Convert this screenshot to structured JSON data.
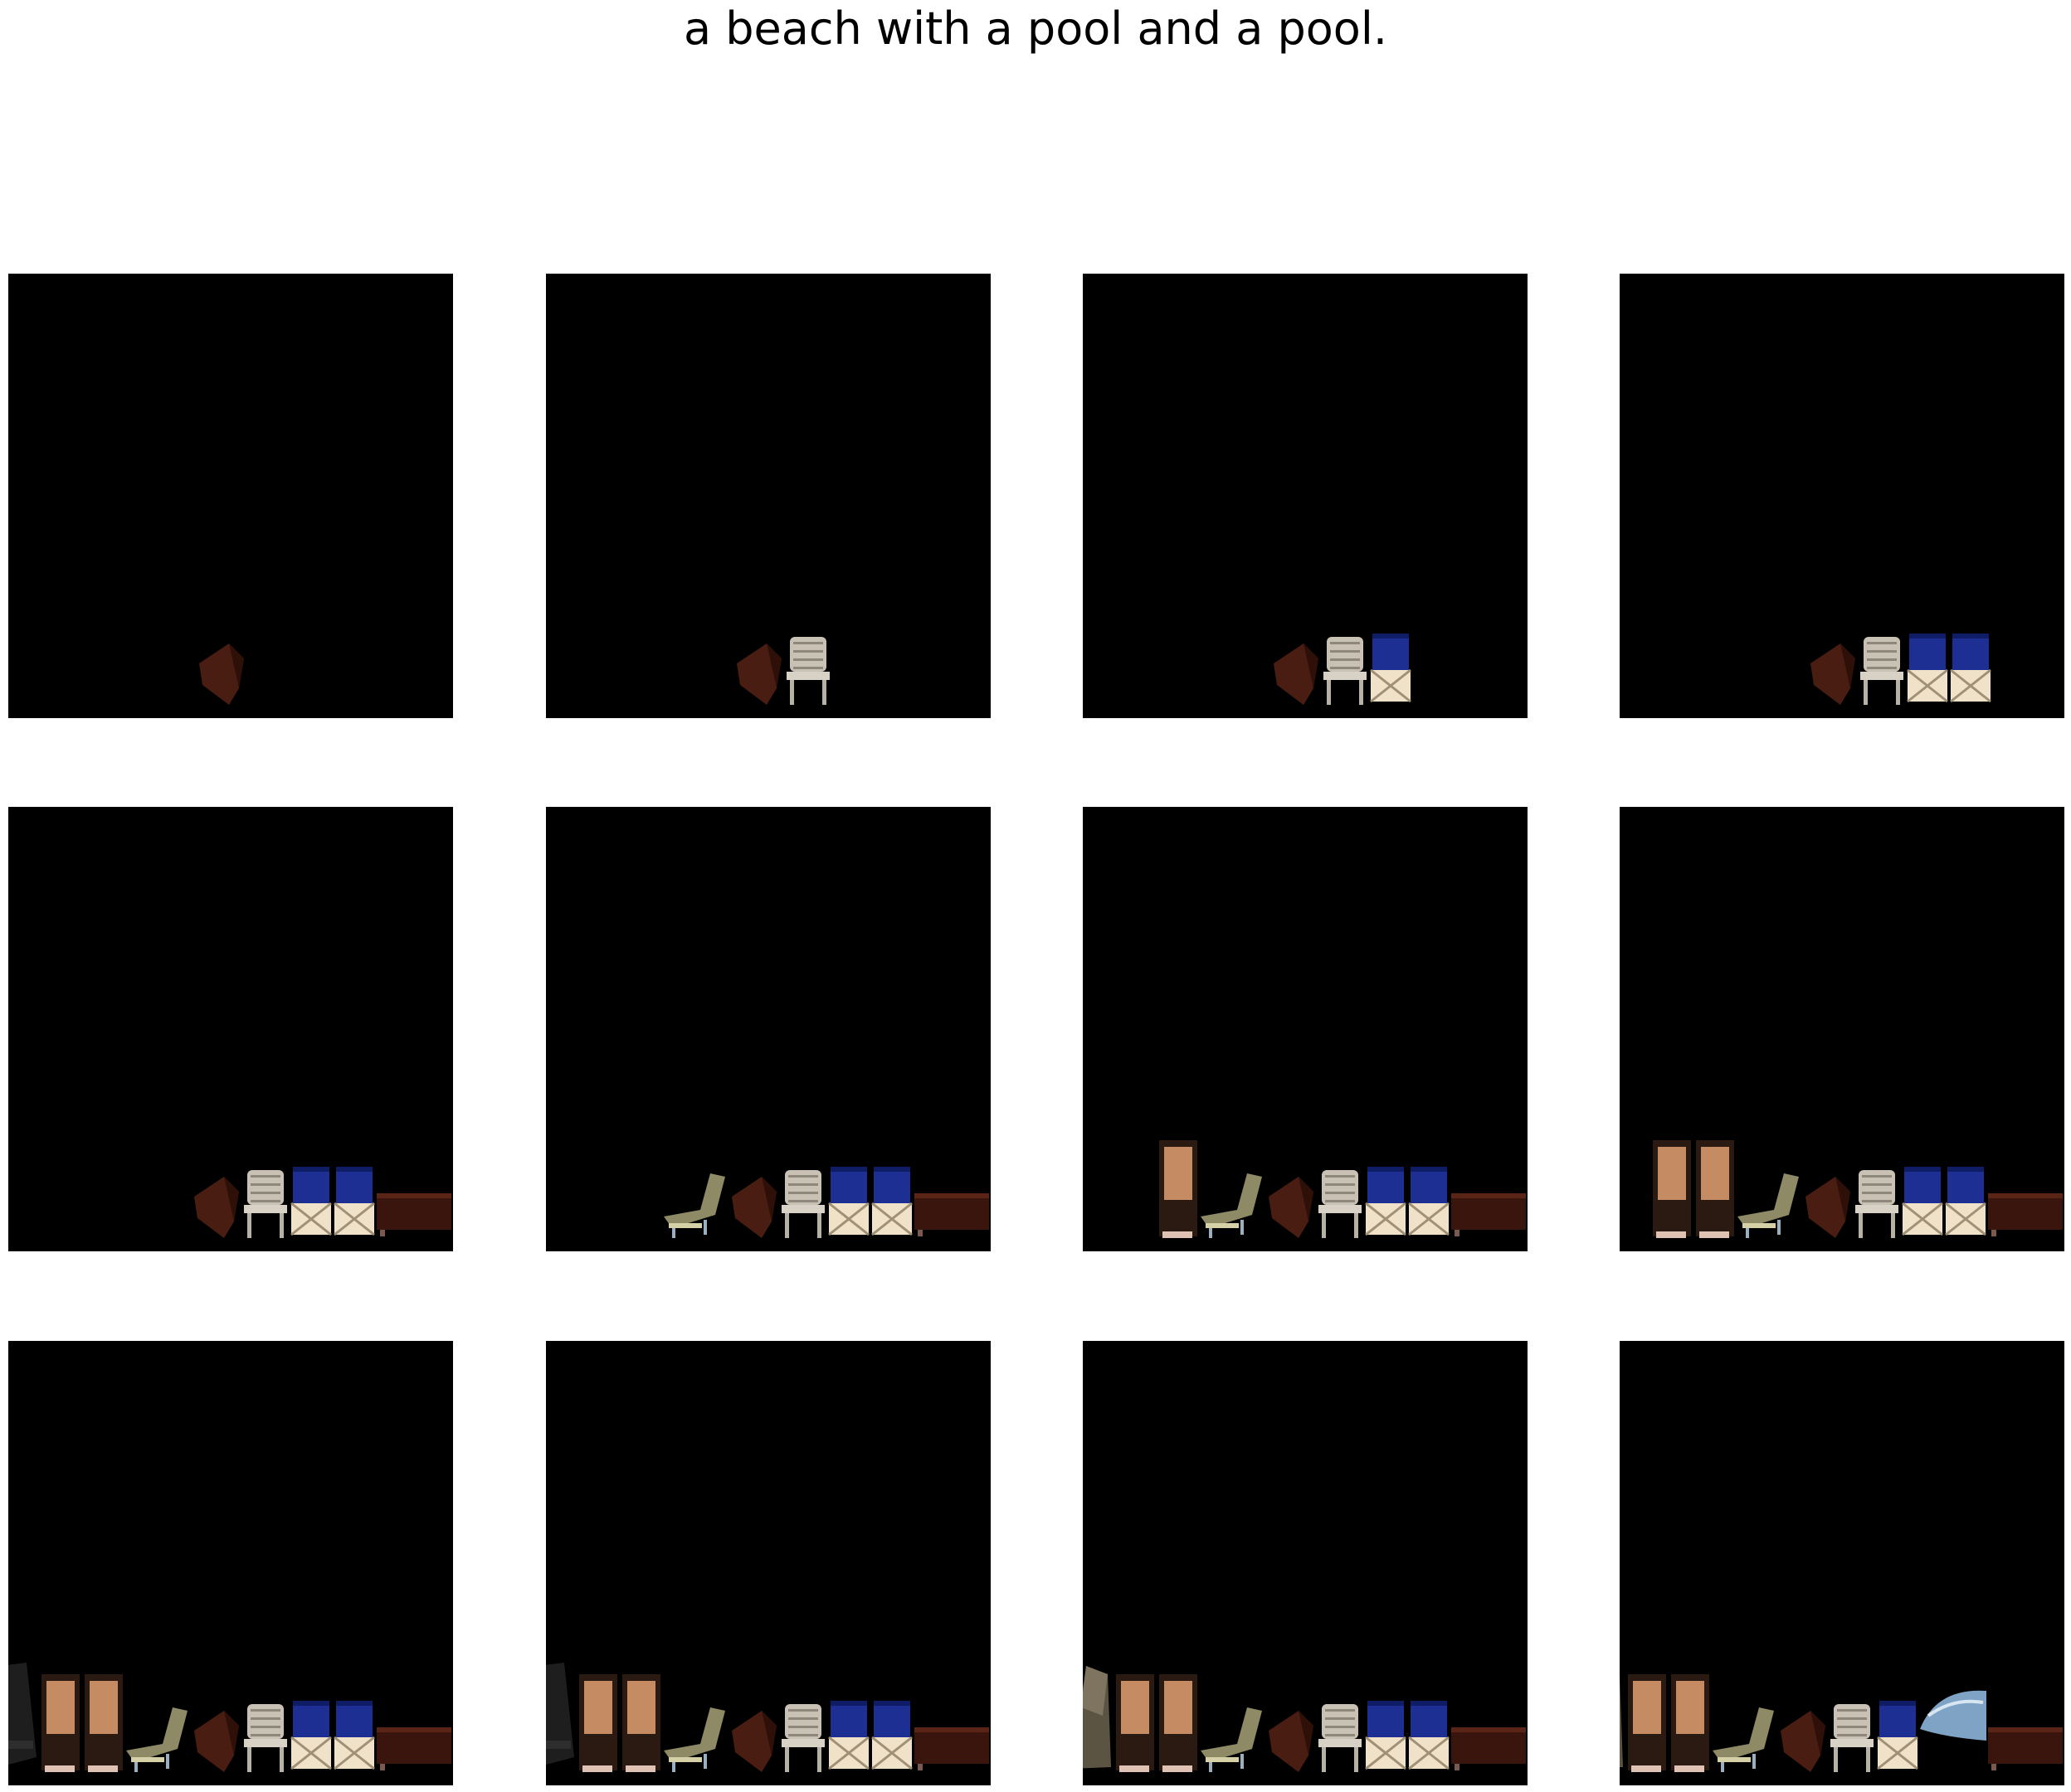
{
  "caption": "a beach with a pool and a pool.",
  "grid": {
    "rows": 3,
    "cols": 4
  },
  "frames": [
    {
      "objects": [
        "dark-chair"
      ]
    },
    {
      "objects": [
        "dark-chair",
        "white-plastic-chair"
      ]
    },
    {
      "objects": [
        "dark-chair",
        "white-plastic-chair",
        "blue-folding-chair"
      ]
    },
    {
      "objects": [
        "dark-chair",
        "white-plastic-chair",
        "blue-folding-chair",
        "blue-folding-chair"
      ]
    },
    {
      "objects": [
        "dark-chair",
        "white-plastic-chair",
        "blue-folding-chair",
        "blue-folding-chair",
        "brown-bench"
      ]
    },
    {
      "objects": [
        "lounge-chair",
        "dark-chair",
        "white-plastic-chair",
        "blue-folding-chair",
        "blue-folding-chair",
        "brown-bench"
      ]
    },
    {
      "objects": [
        "tan-tall-chair",
        "lounge-chair",
        "dark-chair",
        "white-plastic-chair",
        "blue-folding-chair",
        "blue-folding-chair",
        "brown-bench"
      ]
    },
    {
      "objects": [
        "tan-tall-chair",
        "tan-tall-chair",
        "lounge-chair",
        "dark-chair",
        "white-plastic-chair",
        "blue-folding-chair",
        "blue-folding-chair",
        "brown-bench"
      ]
    },
    {
      "objects": [
        "black-chair",
        "tan-tall-chair",
        "tan-tall-chair",
        "lounge-chair",
        "dark-chair",
        "white-plastic-chair",
        "blue-folding-chair",
        "blue-folding-chair",
        "brown-bench"
      ]
    },
    {
      "objects": [
        "black-chair",
        "tan-tall-chair",
        "tan-tall-chair",
        "lounge-chair",
        "dark-chair",
        "white-plastic-chair",
        "blue-folding-chair",
        "blue-folding-chair",
        "brown-bench"
      ]
    },
    {
      "objects": [
        "a-frame-chair",
        "tan-tall-chair",
        "tan-tall-chair",
        "lounge-chair",
        "dark-chair",
        "white-plastic-chair",
        "blue-folding-chair",
        "blue-folding-chair",
        "brown-bench"
      ]
    },
    {
      "objects": [
        "a-frame-chair",
        "tan-tall-chair",
        "tan-tall-chair",
        "lounge-chair",
        "dark-chair",
        "white-plastic-chair",
        "blue-folding-chair",
        "pool-water",
        "brown-bench"
      ]
    }
  ],
  "colors": {
    "background": "#ffffff",
    "frame": "#000000",
    "dark-chair": "#4a1d12",
    "white-plastic-chair": "#c9c2b4",
    "blue-folding-chair": "#1e2f93",
    "folding-base": "#efe2c8",
    "brown-bench": "#3a150d",
    "lounge-chair": "#8e8a66",
    "tan-tall-chair": "#c58b62",
    "black-chair": "#1e1e1e",
    "a-frame-chair": "#5c5442",
    "pool-water": "#7fa3c4"
  }
}
